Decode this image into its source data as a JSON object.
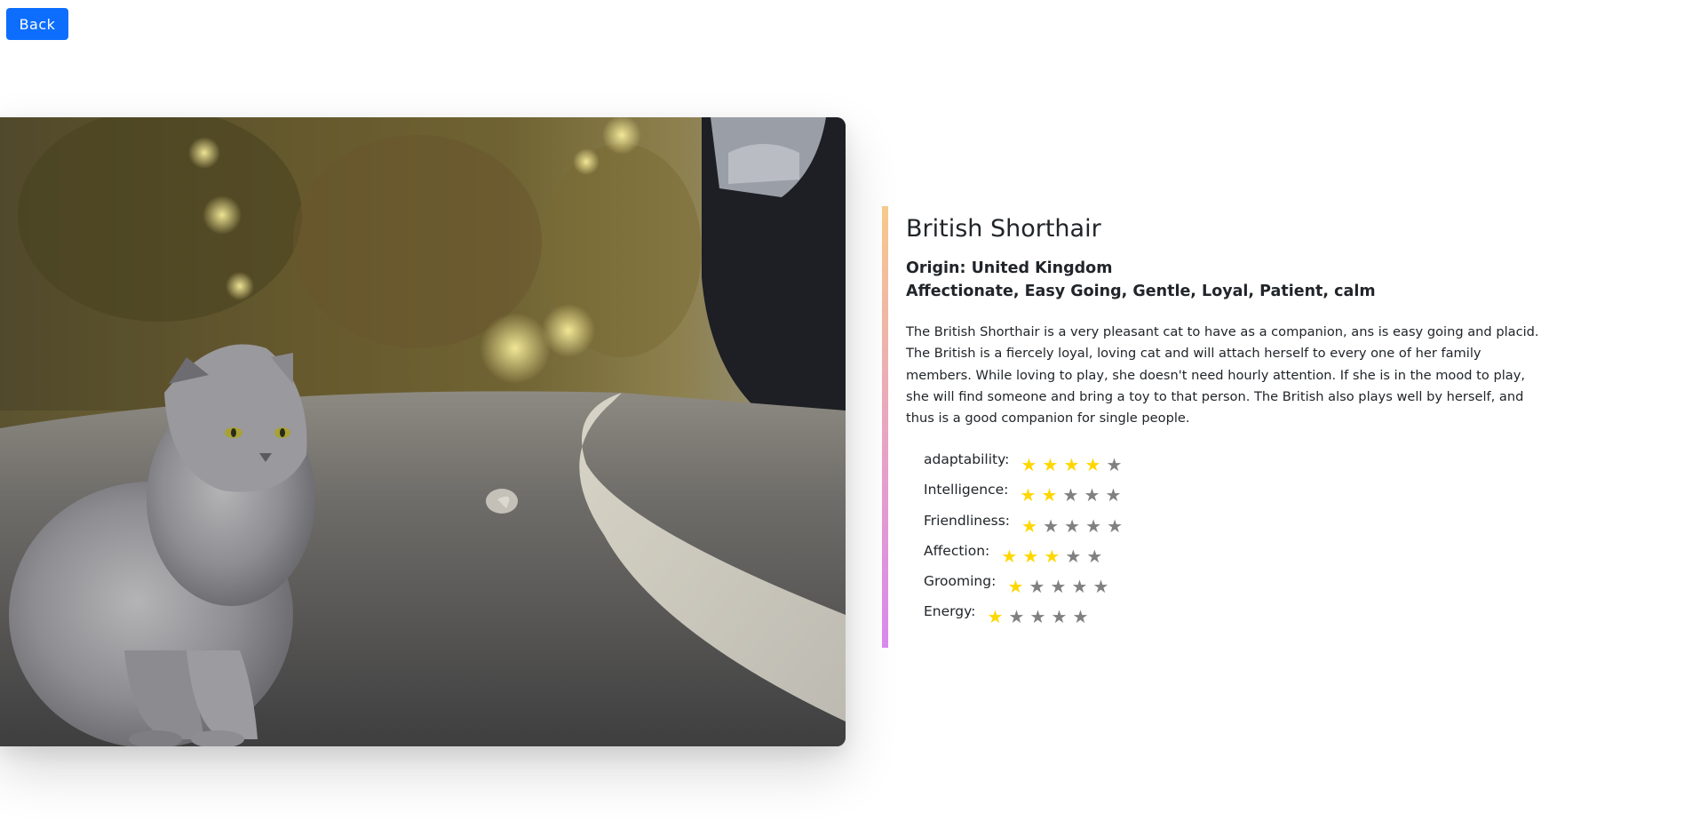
{
  "back_label": "Back",
  "breed": {
    "name": "British Shorthair",
    "origin": "Origin: United Kingdom",
    "temperament": "Affectionate, Easy Going, Gentle, Loyal, Patient, calm",
    "description": "The British Shorthair is a very pleasant cat to have as a companion, ans is easy going and placid. The British is a fiercely loyal, loving cat and will attach herself to every one of her family members. While loving to play, she doesn't need hourly attention. If she is in the mood to play, she will find someone and bring a toy to that person. The British also plays well by herself, and thus is a good companion for single people."
  },
  "ratings": [
    {
      "label": "adaptability:",
      "value": 4,
      "max": 5
    },
    {
      "label": "Intelligence:",
      "value": 2,
      "max": 5
    },
    {
      "label": "Friendliness:",
      "value": 1,
      "max": 5
    },
    {
      "label": "Affection:",
      "value": 3,
      "max": 5
    },
    {
      "label": "Grooming:",
      "value": 1,
      "max": 5
    },
    {
      "label": "Energy:",
      "value": 1,
      "max": 5
    }
  ],
  "colors": {
    "button": "#0d6efd",
    "star_filled": "#ffd700",
    "star_empty": "#808080",
    "accent_top": "#f7c98b",
    "accent_bottom": "#d889ee"
  },
  "icons": {
    "star": "star-icon"
  }
}
